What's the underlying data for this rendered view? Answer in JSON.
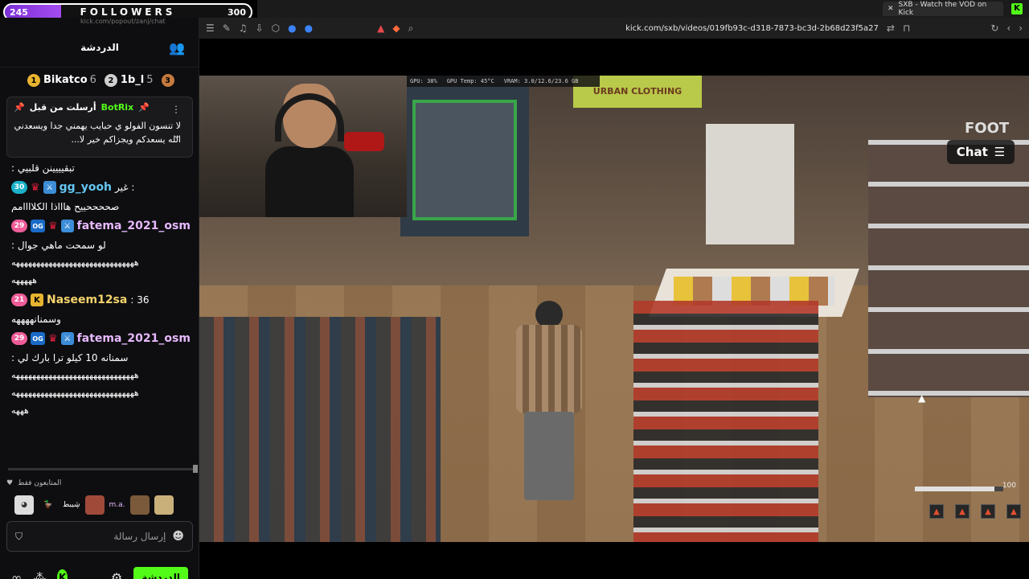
{
  "goal": {
    "start": "245",
    "label": "FOLLOWERS",
    "end": "300",
    "fill_fraction": 0.23,
    "accent": "#a44cf0"
  },
  "browser": {
    "tab_title": "SXB - Watch the VOD on Kick",
    "url": "kick.com/sxb/videos/019fb93c-d318-7873-bc3d-2b68d23f5a27",
    "popout_url": "kick.com/popout/zanj/chat"
  },
  "chat": {
    "title": "الدردشة",
    "leaderboard": [
      {
        "rank": "1",
        "name": "Bikatco",
        "count": "6"
      },
      {
        "rank": "2",
        "name": "1b_l",
        "count": "5"
      },
      {
        "rank": "3",
        "name": "",
        "count": ""
      }
    ],
    "pinned": {
      "sent_by": "أرسلت من قبل",
      "user": "BotRix",
      "text": "لا تنسون الفولو ي حبايب يهمني جدا ويسعدني الله يسعدكم ويجزاكم خير لا..."
    },
    "messages": [
      {
        "text": "تبقيييينن قلبيي :"
      },
      {
        "badge": "30",
        "user": "gg_yooh",
        "body": "غير :",
        "line2": "صححححييح هاااذا الكلاااامم"
      },
      {
        "badge": "29",
        "user": "fatema_2021_osm",
        "line2": "لو سمحت ماهي جوال :",
        "long1": "ههههههههههههههههههههههههههههههه",
        "long2": "هههههه"
      },
      {
        "badge": "21",
        "user": "Naseem12sa",
        "body": ": 36",
        "line2": "وسمنانههههه"
      },
      {
        "badge": "29",
        "user": "fatema_2021_osm",
        "line2": "سمنانه 10 كيلو ترا بارك لي :",
        "long1": "ههههههههههههههههههههههههههههههه",
        "long2": "ههههههههههههههههههههههههههههههه",
        "long3": "هههه"
      }
    ],
    "followers_only": "المتابعون فقط",
    "emote_label": "ڜيبط",
    "emote_label2": "m.a.",
    "input_placeholder": "إرسال رسالة",
    "send_label": "الدردشة"
  },
  "video": {
    "hud": {
      "gpu": "GPU: 38%",
      "temp": "GPU Temp: 45°C",
      "vram": "VRAM: 3.0/12.6/23.6 GB"
    },
    "banner": "URBAN CLOTHING",
    "sign": "FOOT",
    "chat_button": "Chat",
    "health_value": "100",
    "health_fraction": 0.9
  }
}
